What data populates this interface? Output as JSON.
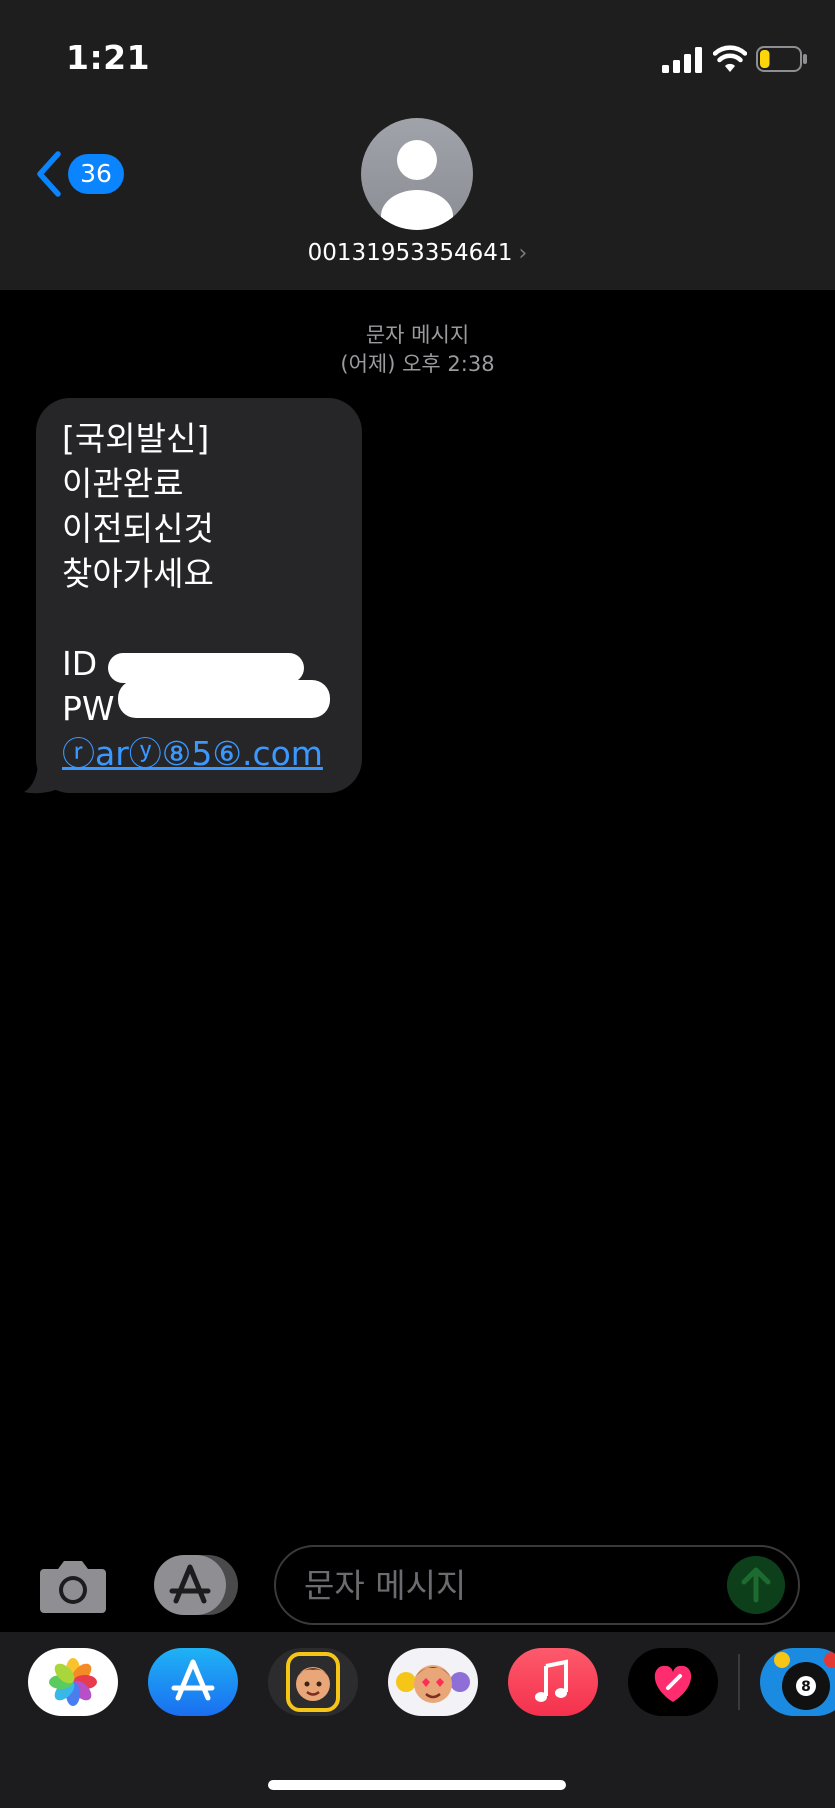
{
  "status_bar": {
    "time": "1:21",
    "battery_level": 0.25,
    "battery_color": "#ffd60a"
  },
  "header": {
    "back_count": "36",
    "contact": "00131953354641",
    "accent": "#0a84ff"
  },
  "conversation": {
    "type_label": "문자 메시지",
    "timestamp": "(어제) 오후 2:38",
    "message": {
      "lines": [
        "[국외발신]",
        "이관완료",
        "이전되신것",
        "찾아가세요"
      ],
      "id_label": "ID",
      "pw_label": "PW",
      "link": "ⓡarⓨ⑧5⑥.com"
    }
  },
  "input_bar": {
    "placeholder": "문자 메시지",
    "icons": [
      "camera-icon",
      "app-store-icon",
      "send-arrow-icon"
    ]
  },
  "app_drawer": {
    "apps": [
      "photos",
      "app-store",
      "memoji",
      "animoji-stickers",
      "music",
      "digital-touch",
      "8-ball-pool"
    ]
  }
}
